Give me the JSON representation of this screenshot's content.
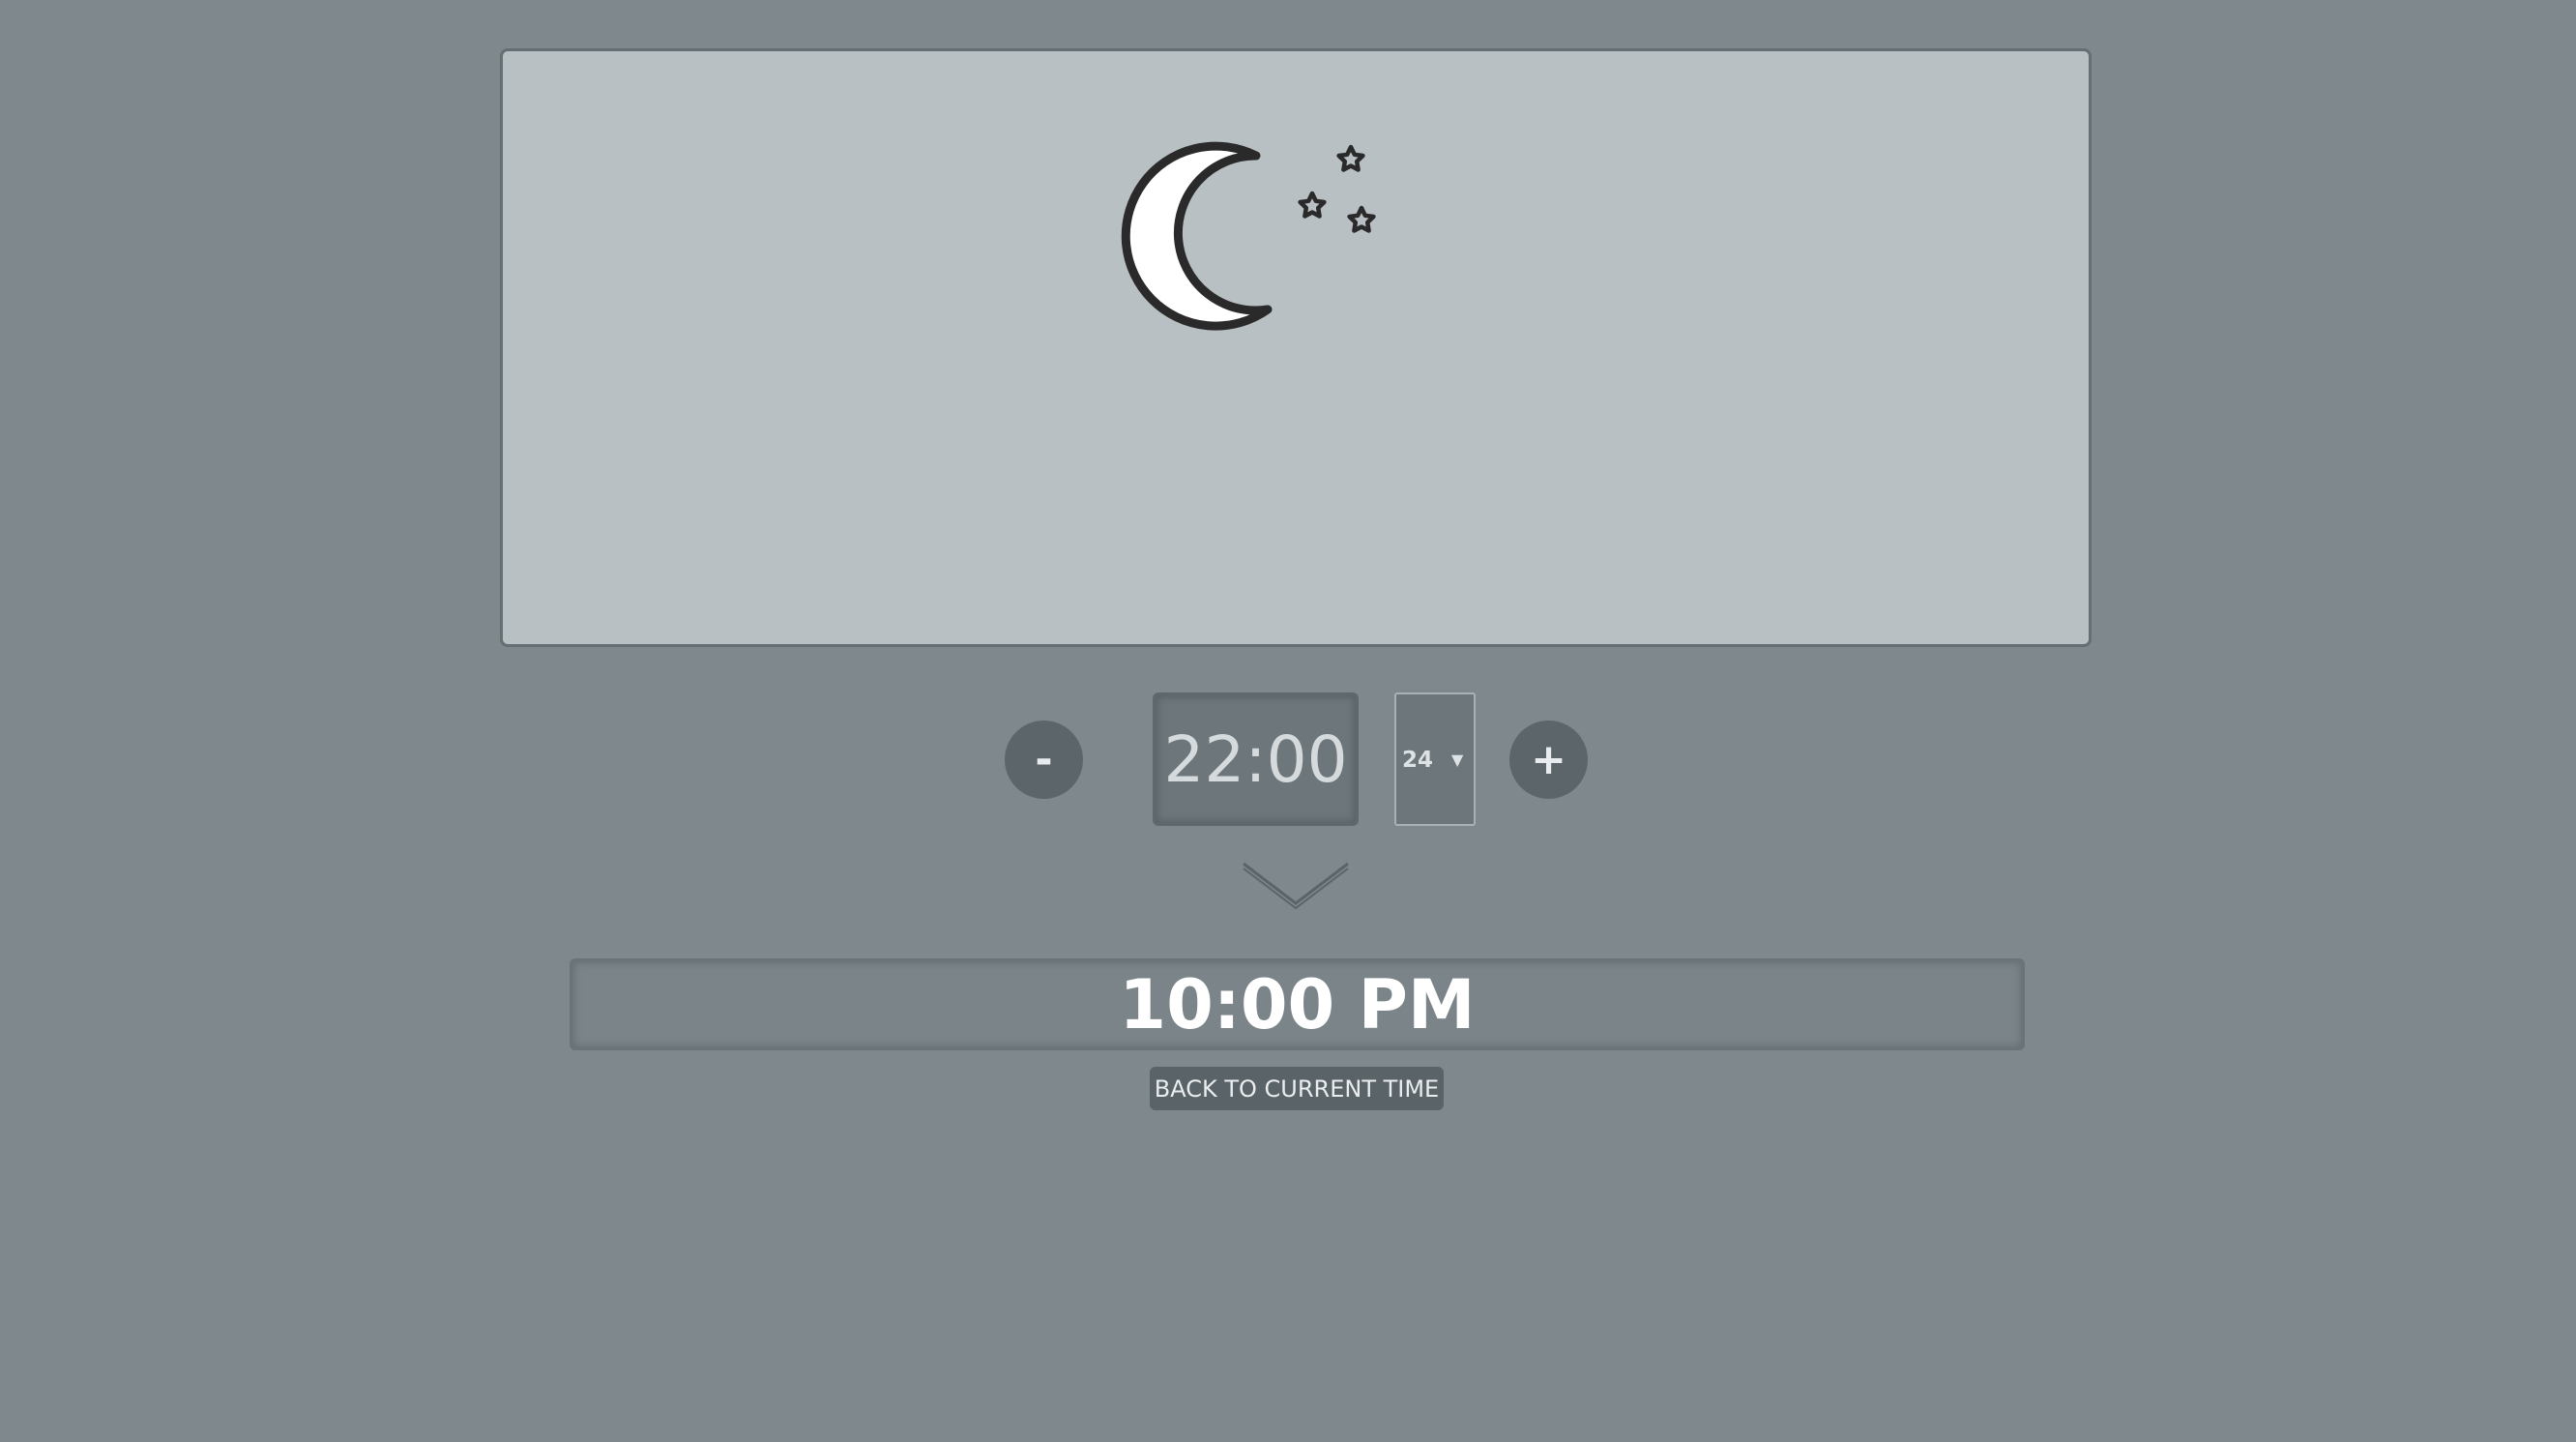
{
  "sky": {
    "icon": "moon-and-stars-icon",
    "moon_fill": "#ffffff",
    "outline_color": "#2a2a2a",
    "panel_color": "#b9c0c3"
  },
  "controls": {
    "decrement_label": "-",
    "increment_label": "+",
    "time_value": "22:00",
    "format_selected": "24",
    "format_options": [
      "24"
    ]
  },
  "converted": {
    "time_text": "10:00 PM"
  },
  "back_button": {
    "label": "BACK TO CURRENT TIME"
  },
  "colors": {
    "background": "#7e888d",
    "button": "#5c6569"
  }
}
